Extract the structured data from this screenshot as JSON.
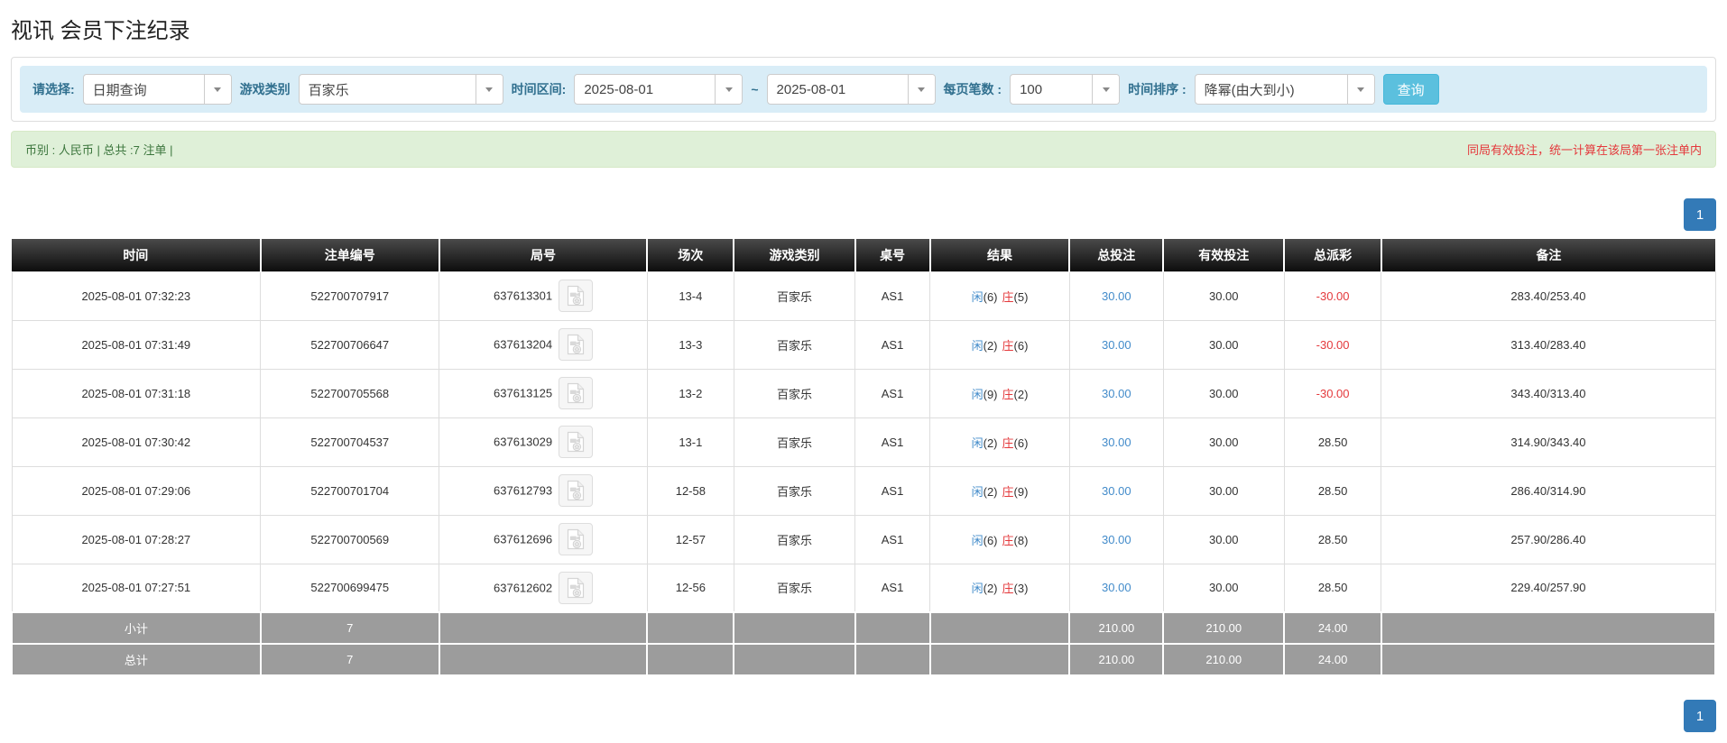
{
  "page": {
    "title": "视讯 会员下注纪录"
  },
  "colors": {
    "filter_bg": "#d9edf7",
    "filter_label": "#31708f",
    "search_button": "#5bc0de",
    "alert_bg": "#dff0d8",
    "alert_text": "#3c763d",
    "alert_warning_text": "#e4393c",
    "pagination_active": "#337ab7",
    "link_blue": "#428bca",
    "negative_red": "#e4393c",
    "header_black": "#1a1a1a",
    "footer_grey": "#9c9c9c"
  },
  "filters": {
    "query_label": "请选择:",
    "query_value": "日期查询",
    "game_type_label": "游戏类别",
    "game_type_value": "百家乐",
    "time_range_label": "时间区间:",
    "date_from": "2025-08-01",
    "tilde": "~",
    "date_to": "2025-08-01",
    "page_size_label": "每页笔数 :",
    "page_size_value": "100",
    "sort_label": "时间排序 :",
    "sort_value": "降幂(由大到小)",
    "search_button_label": "查询"
  },
  "summary": {
    "left_text": "币别 : 人民币 | 总共 :7 注单 |",
    "right_text": "同局有效投注，统一计算在该局第一张注单内"
  },
  "pagination": {
    "current_page": "1"
  },
  "table": {
    "headers": [
      "时间",
      "注单编号",
      "局号",
      "场次",
      "游戏类别",
      "桌号",
      "结果",
      "总投注",
      "有效投注",
      "总派彩",
      "备注"
    ],
    "video_icon": "film-file-icon",
    "rows": [
      {
        "time": "2025-08-01 07:32:23",
        "bet_no": "522700707917",
        "round_no": "637613301",
        "session": "13-4",
        "game": "百家乐",
        "table_no": "AS1",
        "result_p": "闲",
        "result_p_n": "(6)",
        "result_b": "庄",
        "result_b_n": "(5)",
        "total_bet": "30.00",
        "valid_bet": "30.00",
        "payout": "-30.00",
        "remark": "283.40/253.40"
      },
      {
        "time": "2025-08-01 07:31:49",
        "bet_no": "522700706647",
        "round_no": "637613204",
        "session": "13-3",
        "game": "百家乐",
        "table_no": "AS1",
        "result_p": "闲",
        "result_p_n": "(2)",
        "result_b": "庄",
        "result_b_n": "(6)",
        "total_bet": "30.00",
        "valid_bet": "30.00",
        "payout": "-30.00",
        "remark": "313.40/283.40"
      },
      {
        "time": "2025-08-01 07:31:18",
        "bet_no": "522700705568",
        "round_no": "637613125",
        "session": "13-2",
        "game": "百家乐",
        "table_no": "AS1",
        "result_p": "闲",
        "result_p_n": "(9)",
        "result_b": "庄",
        "result_b_n": "(2)",
        "total_bet": "30.00",
        "valid_bet": "30.00",
        "payout": "-30.00",
        "remark": "343.40/313.40"
      },
      {
        "time": "2025-08-01 07:30:42",
        "bet_no": "522700704537",
        "round_no": "637613029",
        "session": "13-1",
        "game": "百家乐",
        "table_no": "AS1",
        "result_p": "闲",
        "result_p_n": "(2)",
        "result_b": "庄",
        "result_b_n": "(6)",
        "total_bet": "30.00",
        "valid_bet": "30.00",
        "payout": "28.50",
        "remark": "314.90/343.40"
      },
      {
        "time": "2025-08-01 07:29:06",
        "bet_no": "522700701704",
        "round_no": "637612793",
        "session": "12-58",
        "game": "百家乐",
        "table_no": "AS1",
        "result_p": "闲",
        "result_p_n": "(2)",
        "result_b": "庄",
        "result_b_n": "(9)",
        "total_bet": "30.00",
        "valid_bet": "30.00",
        "payout": "28.50",
        "remark": "286.40/314.90"
      },
      {
        "time": "2025-08-01 07:28:27",
        "bet_no": "522700700569",
        "round_no": "637612696",
        "session": "12-57",
        "game": "百家乐",
        "table_no": "AS1",
        "result_p": "闲",
        "result_p_n": "(6)",
        "result_b": "庄",
        "result_b_n": "(8)",
        "total_bet": "30.00",
        "valid_bet": "30.00",
        "payout": "28.50",
        "remark": "257.90/286.40"
      },
      {
        "time": "2025-08-01 07:27:51",
        "bet_no": "522700699475",
        "round_no": "637612602",
        "session": "12-56",
        "game": "百家乐",
        "table_no": "AS1",
        "result_p": "闲",
        "result_p_n": "(2)",
        "result_b": "庄",
        "result_b_n": "(3)",
        "total_bet": "30.00",
        "valid_bet": "30.00",
        "payout": "28.50",
        "remark": "229.40/257.90"
      }
    ],
    "footer": [
      {
        "label": "小计",
        "count": "7",
        "total_bet": "210.00",
        "valid_bet": "210.00",
        "payout": "24.00"
      },
      {
        "label": "总计",
        "count": "7",
        "total_bet": "210.00",
        "valid_bet": "210.00",
        "payout": "24.00"
      }
    ]
  }
}
